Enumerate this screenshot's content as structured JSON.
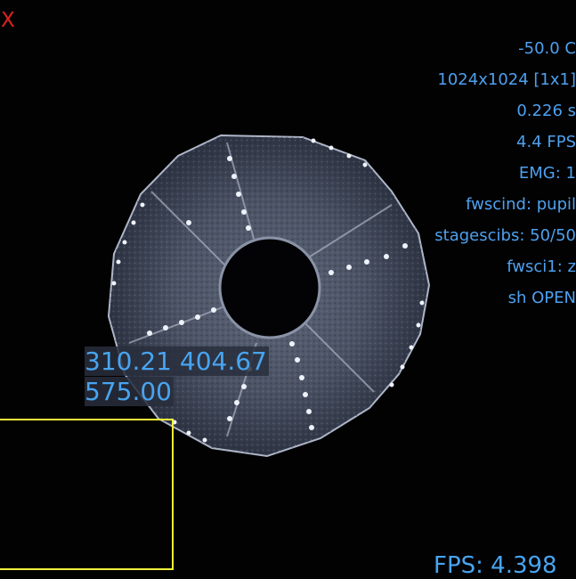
{
  "window": {
    "close_label": "X"
  },
  "status_lines": [
    "-50.0 C",
    "1024x1024 [1x1]",
    "0.226 s",
    "4.4 FPS",
    "EMG: 1",
    "fwscind: pupil",
    "stagescibs: 50/50",
    "fwsci1: z",
    "sh OPEN"
  ],
  "cursor": {
    "line1": "310.21 404.67",
    "line2": "575.00"
  },
  "footer": {
    "fps_text": "FPS: 4.398"
  },
  "colors": {
    "status_text": "#4ea0ee",
    "roi_box": "#f4f43a",
    "close_icon": "#e02020"
  }
}
